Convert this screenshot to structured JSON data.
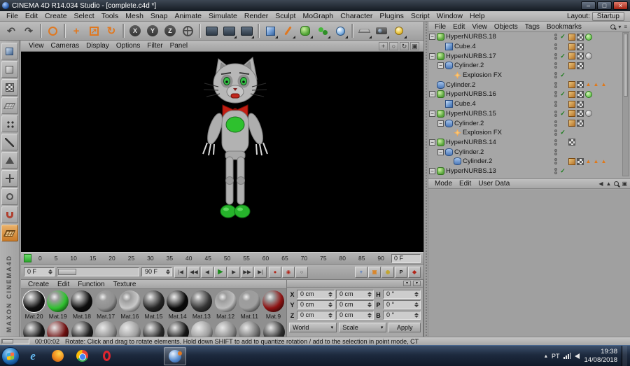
{
  "window": {
    "title": "CINEMA 4D R14.034 Studio - [complete.c4d *]",
    "menus": [
      "File",
      "Edit",
      "Create",
      "Select",
      "Tools",
      "Mesh",
      "Snap",
      "Animate",
      "Simulate",
      "Render",
      "Sculpt",
      "MoGraph",
      "Character",
      "Plugins",
      "Script",
      "Window",
      "Help"
    ],
    "layout_label": "Layout:",
    "layout_value": "Startup",
    "controls": {
      "minimize": "–",
      "maximize": "□",
      "close": "×"
    }
  },
  "toolbar": {
    "items": [
      {
        "name": "undo-button",
        "glyph": "↶",
        "cls": "ic-arrow"
      },
      {
        "name": "redo-button",
        "glyph": "↷",
        "cls": "ic-arrow"
      },
      {
        "sep": true
      },
      {
        "name": "live-selection-button",
        "cls": "ic-ring"
      },
      {
        "sep": true
      },
      {
        "name": "move-tool-button",
        "glyph": "+",
        "cls": "ic-orange"
      },
      {
        "name": "scale-tool-button",
        "glyph": "↗",
        "cls": "ic-scale"
      },
      {
        "name": "rotate-tool-button",
        "glyph": "↻",
        "cls": "ic-orange"
      },
      {
        "sep": true
      },
      {
        "name": "axis-x-button",
        "glyph": "X",
        "cls": "ic-axis"
      },
      {
        "name": "axis-y-button",
        "glyph": "Y",
        "cls": "ic-axis"
      },
      {
        "name": "axis-z-button",
        "glyph": "Z",
        "cls": "ic-axis"
      },
      {
        "name": "coordinate-system-button",
        "cls": "ic-coord"
      },
      {
        "sep": true
      },
      {
        "name": "render-view-button",
        "cls": "ic-render"
      },
      {
        "name": "render-picture-viewer-button",
        "cls": "ic-render",
        "dd": true
      },
      {
        "name": "render-settings-button",
        "cls": "ic-render",
        "dd": true
      },
      {
        "sep": true
      },
      {
        "name": "add-cube-primitive-button",
        "cls": "ic-cube",
        "dd": true
      },
      {
        "name": "add-spline-button",
        "cls": "ic-pen",
        "dd": true
      },
      {
        "name": "add-hypernurbs-button",
        "cls": "ic-hn",
        "dd": true
      },
      {
        "name": "add-mograph-button",
        "cls": "ic-mg",
        "dd": true
      },
      {
        "name": "add-deformer-button",
        "cls": "ic-sphere",
        "dd": true
      },
      {
        "sep": true
      },
      {
        "name": "add-environment-button",
        "cls": "ic-floor",
        "dd": true
      },
      {
        "name": "add-camera-button",
        "cls": "ic-cam",
        "dd": true
      },
      {
        "name": "add-light-button",
        "cls": "ic-light",
        "dd": true
      }
    ]
  },
  "sidebar_tools": [
    {
      "name": "make-editable-button",
      "cls": "s-cube"
    },
    {
      "name": "model-mode-button",
      "cls": "s-model"
    },
    {
      "name": "texture-mode-button",
      "cls": "s-tex"
    },
    {
      "name": "workplane-mode-button",
      "cls": "s-plane"
    },
    {
      "name": "points-mode-button",
      "cls": "s-points"
    },
    {
      "name": "edges-mode-button",
      "cls": "s-edge"
    },
    {
      "name": "polygons-mode-button",
      "cls": "s-poly"
    },
    {
      "name": "enable-axis-button",
      "cls": "s-axis"
    },
    {
      "name": "viewport-solo-button",
      "cls": "s-solo"
    },
    {
      "name": "snap-button",
      "cls": "s-snap"
    },
    {
      "name": "workplane-snap-button",
      "cls": "s-wsnap",
      "active": true
    }
  ],
  "viewport": {
    "menus": [
      "View",
      "Cameras",
      "Display",
      "Options",
      "Filter",
      "Panel"
    ],
    "corner_icons": [
      {
        "name": "pan-view-icon",
        "glyph": "+"
      },
      {
        "name": "zoom-view-icon",
        "glyph": "○"
      },
      {
        "name": "rotate-view-icon",
        "glyph": "↻"
      },
      {
        "name": "toggle-view-icon",
        "glyph": "▣"
      }
    ]
  },
  "object_manager": {
    "menus": [
      "File",
      "Edit",
      "View",
      "Objects",
      "Tags",
      "Bookmarks"
    ],
    "items": [
      {
        "label": "HyperNURBS.18",
        "indent": 0,
        "type": "hypernurbs",
        "parent": true,
        "check": true,
        "tags": [
          "texture",
          "checker",
          "ball-green"
        ]
      },
      {
        "label": "Cube.4",
        "indent": 1,
        "type": "cube",
        "tags": [
          "texture",
          "checker"
        ]
      },
      {
        "label": "HyperNURBS.17",
        "indent": 0,
        "type": "hypernurbs",
        "parent": true,
        "check": true,
        "tags": [
          "texture",
          "checker",
          "ball-gray"
        ]
      },
      {
        "label": "Cylinder.2",
        "indent": 1,
        "type": "cylinder",
        "parent": true,
        "tags": [
          "texture",
          "checker"
        ]
      },
      {
        "label": "Explosion FX",
        "indent": 2,
        "type": "explosion",
        "check": true,
        "tags": []
      },
      {
        "label": "Cylinder.2",
        "indent": 0,
        "type": "cylinder",
        "tags": [
          "texture",
          "checker"
        ],
        "warn": true
      },
      {
        "label": "HyperNURBS.16",
        "indent": 0,
        "type": "hypernurbs",
        "parent": true,
        "check": true,
        "tags": [
          "texture",
          "checker",
          "ball-green"
        ]
      },
      {
        "label": "Cube.4",
        "indent": 1,
        "type": "cube",
        "tags": [
          "texture",
          "checker"
        ]
      },
      {
        "label": "HyperNURBS.15",
        "indent": 0,
        "type": "hypernurbs",
        "parent": true,
        "check": true,
        "tags": [
          "texture",
          "checker",
          "ball-gray"
        ]
      },
      {
        "label": "Cylinder.2",
        "indent": 1,
        "type": "cylinder",
        "parent": true,
        "tags": [
          "texture",
          "checker"
        ]
      },
      {
        "label": "Explosion FX",
        "indent": 2,
        "type": "explosion",
        "check": true,
        "tags": []
      },
      {
        "label": "HyperNURBS.14",
        "indent": 0,
        "type": "hypernurbs",
        "parent": true,
        "tags": [
          "checker"
        ]
      },
      {
        "label": "Cylinder.2",
        "indent": 1,
        "type": "cylinder",
        "parent": true,
        "tags": []
      },
      {
        "label": "Cylinder.2",
        "indent": 2,
        "type": "cylinder",
        "tags": [
          "texture",
          "checker"
        ],
        "warn": true
      },
      {
        "label": "HyperNURBS.13",
        "indent": 0,
        "type": "hypernurbs",
        "parent": true,
        "check": true,
        "tags": []
      }
    ]
  },
  "attributes": {
    "menus": [
      "Mode",
      "Edit",
      "User Data"
    ]
  },
  "timeline": {
    "ticks": [
      "0",
      "5",
      "10",
      "15",
      "20",
      "25",
      "30",
      "35",
      "40",
      "45",
      "50",
      "55",
      "60",
      "65",
      "70",
      "75",
      "80",
      "85",
      "90"
    ],
    "right_field": "0 F"
  },
  "anim": {
    "start_field": "0 F",
    "end_field": "90 F",
    "transport": [
      {
        "name": "go-to-start-button",
        "glyph": "|◀"
      },
      {
        "name": "previous-key-button",
        "glyph": "◀◀"
      },
      {
        "name": "previous-frame-button",
        "glyph": "◀"
      },
      {
        "name": "play-button",
        "glyph": "▶"
      },
      {
        "name": "next-frame-button",
        "glyph": "▶"
      },
      {
        "name": "next-key-button",
        "glyph": "▶▶"
      },
      {
        "name": "go-to-end-button",
        "glyph": "▶|"
      }
    ],
    "record_icons": [
      {
        "name": "record-button",
        "glyph": "●",
        "color": "#b22418"
      },
      {
        "name": "autokey-button",
        "glyph": "◉",
        "color": "#b22418"
      },
      {
        "name": "keyframe-selection-button",
        "glyph": "○",
        "color": "#555555"
      }
    ],
    "right_icons": [
      {
        "name": "record-position-icon",
        "glyph": "+",
        "color": "#3f6fc2"
      },
      {
        "name": "record-scale-icon",
        "glyph": "▣",
        "color": "#d9862b"
      },
      {
        "name": "record-rotation-icon",
        "glyph": "◉",
        "color": "#c2a52b"
      },
      {
        "name": "parameter-record-button",
        "glyph": "P",
        "color": "#222222"
      },
      {
        "name": "point-level-animation-icon",
        "glyph": "◆",
        "color": "#b22418"
      }
    ]
  },
  "materials": {
    "menus": [
      "Create",
      "Edit",
      "Function",
      "Texture"
    ],
    "items": [
      {
        "name": "Mat.20",
        "color": "#101010",
        "selected": true
      },
      {
        "name": "Mat.19",
        "color": "#2fc12f"
      },
      {
        "name": "Mat.18",
        "color": "#0d0d0d"
      },
      {
        "name": "Mat.17",
        "color": "#8f8f8f"
      },
      {
        "name": "Mat.16",
        "color": "#c8c8c8"
      },
      {
        "name": "Mat.15",
        "color": "#262626"
      },
      {
        "name": "Mat.14",
        "color": "#0a0a0a"
      },
      {
        "name": "Mat.13",
        "color": "#353535"
      },
      {
        "name": "Mat.12",
        "color": "#bdbdbd"
      },
      {
        "name": "Mat.11",
        "color": "#9e9e9e"
      },
      {
        "name": "Mat.9",
        "color": "#8e1313"
      }
    ],
    "partial_row_colors": [
      "#151515",
      "#6e1010",
      "#1d1d1d",
      "#8a8a8a",
      "#9c9c9c",
      "#2a2a2a",
      "#161616",
      "#9a9a9a",
      "#858585",
      "#6f6f6f",
      "#303030"
    ]
  },
  "coordinates": {
    "rows": [
      {
        "axis": "X",
        "pos": "0 cm",
        "size": "0 cm",
        "rot_label": "H",
        "rot": "0 °"
      },
      {
        "axis": "Y",
        "pos": "0 cm",
        "size": "0 cm",
        "rot_label": "P",
        "rot": "0 °"
      },
      {
        "axis": "Z",
        "pos": "0 cm",
        "size": "0 cm",
        "rot_label": "B",
        "rot": "0 °"
      }
    ],
    "world": "World",
    "scale": "Scale",
    "apply": "Apply"
  },
  "status": {
    "time": "00:00:02",
    "text": "Rotate: Click and drag to rotate elements. Hold down SHIFT to add to quantize rotation / add to the selection in point mode, CT"
  },
  "branding": {
    "vertical": "MAXON CINEMA4D"
  },
  "taskbar": {
    "lang": "PT",
    "time": "19:38",
    "date": "14/08/2018",
    "hidden_icons_glyph": "▴"
  },
  "icons": {
    "ie": "e"
  }
}
